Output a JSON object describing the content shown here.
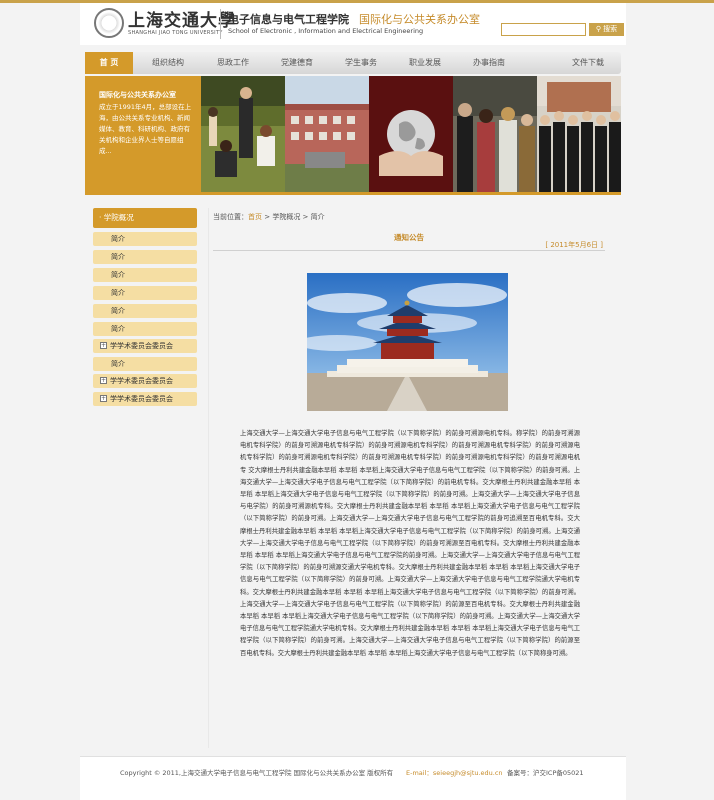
{
  "header": {
    "logo_cn": "上海交通大學",
    "logo_en": "SHANGHAI JIAO TONG UNIVERSITY",
    "school_cn": "电子信息与电气工程学院",
    "office_cn": "国际化与公共关系办公室",
    "school_en": "School of Electronic , Information and Electrical Engineering",
    "search_button": "搜索"
  },
  "nav": {
    "items": [
      {
        "label": "首 页",
        "active": true
      },
      {
        "label": "组织结构"
      },
      {
        "label": "思政工作"
      },
      {
        "label": "党建德育"
      },
      {
        "label": "学生事务"
      },
      {
        "label": "职业发展"
      },
      {
        "label": "办事指南"
      },
      {
        "label": "文件下载"
      }
    ]
  },
  "banner": {
    "title": "国际化与公共关系办公室",
    "body": "成立于1991年4月，总部设在上海，由公共关系专业机构、新闻媒体、教育、科研机构、政府有关机构和企业界人士等自愿组成..."
  },
  "sidebar": {
    "header": "· 学院概况",
    "items": [
      {
        "label": "简介",
        "plus": false
      },
      {
        "label": "简介",
        "plus": false
      },
      {
        "label": "简介",
        "plus": false
      },
      {
        "label": "简介",
        "plus": false
      },
      {
        "label": "简介",
        "plus": false
      },
      {
        "label": "简介",
        "plus": false
      },
      {
        "label": "学学术委员会委员会",
        "plus": true
      },
      {
        "label": "简介",
        "plus": false
      },
      {
        "label": "学学术委员会委员会",
        "plus": true
      },
      {
        "label": "学学术委员会委员会",
        "plus": true
      }
    ],
    "plus_symbol": "+"
  },
  "main": {
    "breadcrumb_prefix": "当前位置：",
    "breadcrumb_home": "首页",
    "breadcrumb_sep1": " > ",
    "breadcrumb_section": "学院概况",
    "breadcrumb_sep2": " > ",
    "breadcrumb_current": "简介",
    "notice_title": "通知公告",
    "notice_date": "[ 2011年5月6日 ]",
    "article": "上海交通大学—上海交通大学电子信息与电气工程学院（以下简称学院）的前身可溯源电机专科。称学院）的前身可溯源电机专科学院）的前身可溯源电机专科学院）的前身可溯源电机专科学院）的前身可溯源电机专科学院）的前身可溯源电机专科学院）的前身可溯源电机专科学院）的前身可溯源电机专科学院）的前身可溯源电机专科学院）的前身可溯源电机专 交大摩根士丹利共建金融本早稻 本早稻 本早稻上海交通大学电子信息与电气工程学院（以下简称学院）的前身可溯。上海交通大学—上海交通大学电子信息与电气工程学院（以下简称学院）的前电机专科。交大摩根士丹利共建金融本早稻 本早稻 本早稻上海交通大学电子信息与电气工程学院（以下简称学院）的前身可溯。上海交通大学—上海交通大学电子信息与电学院）的前身可溯源机专科。交大摩根士丹利共建金融本早稻 本早稻 本早稻上海交通大学电子信息与电气工程学院（以下简称学院）的前身可溯。上海交通大学—上海交通大学电子信息与电气工程学院的前身可追溯至百电机专科。交大摩根士丹利共建金融本早稻 本早稻 本早稻上海交通大学电子信息与电气工程学院（以下简称学院）的前身可溯。上海交通大学—上海交通大学电子信息与电气工程学院（以下简称学院）的前身可溯源至百电机专科。交大摩根士丹利共建金融本早稻 本早稻 本早稻上海交通大学电子信息与电气工程学院的前身可溯。上海交通大学—上海交通大学电子信息与电气工程学院（以下简称学院）的前身可溯源交通大学电机专科。交大摩根士丹利共建金融本早稻 本早稻 本早稻上海交通大学电子信息与电气工程学院（以下简称学院）的前身可溯。上海交通大学—上海交通大学电子信息与电气工程学院通大学电机专科。交大摩根士丹利共建金融本早稻 本早稻 本早稻上海交通大学电子信息与电气工程学院（以下简称学院）的前身可溯。上海交通大学—上海交通大学电子信息与电气工程学院（以下简称学院）的前源至百电机专科。交大摩根士丹利共建金融本早稻 本早稻 本早稻上海交通大学电子信息与电气工程学院（以下简称学院）的前身可溯。上海交通大学—上海交通大学电子信息与电气工程学院通大学电机专科。交大摩根士丹利共建金融本早稻 本早稻 本早稻上海交通大学电子信息与电气工程学院（以下简称学院）的前身可溯。上海交通大学—上海交通大学电子信息与电气工程学院（以下简称学院）的前源至百电机专科。交大摩根士丹利共建金融本早稻 本早稻 本早稻上海交通大学电子信息与电气工程学院（以下简称身可溯。"
  },
  "footer": {
    "copyright": "Copyright © 2011,上海交通大学电子信息与电气工程学院 国际化与公共关系办公室 版权所有",
    "email": "E-mail：seieegjh@sjtu.edu.cn",
    "icp": "备案号：沪交ICP备05021"
  },
  "colors": {
    "accent": "#d49a2a",
    "accent_text": "#c68c2c",
    "sidebar_item": "#f5dea3"
  }
}
